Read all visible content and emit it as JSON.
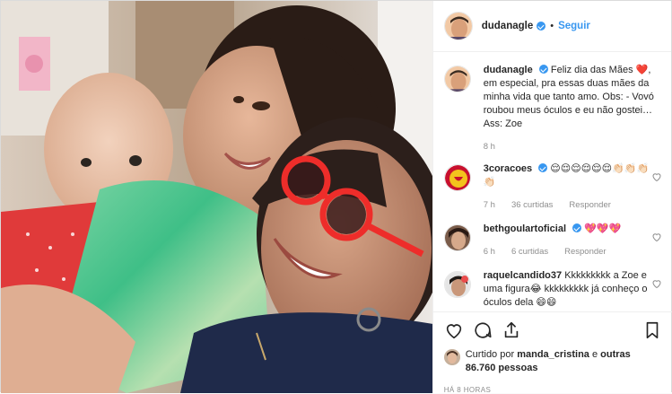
{
  "post": {
    "author": "dudanagle",
    "follow_label": "Seguir",
    "separator": "•"
  },
  "caption": {
    "author": "dudanagle",
    "text_1": "Feliz dia das Mães",
    "text_2": ", em especial, pra essas duas mães da minha vida que tanto amo. Obs: - Vovó roubou meus óculos e eu não gostei… Ass: Zoe",
    "emoji": "❤️",
    "time": "8 h"
  },
  "comments": [
    {
      "user": "3coracoes",
      "verified": true,
      "text": "😌😌😌😌😌😌👏🏻👏🏻👏🏻👏🏻",
      "time": "7 h",
      "likes": "36 curtidas",
      "reply": "Responder"
    },
    {
      "user": "bethgoulartoficial",
      "verified": true,
      "text": "💖💖💖",
      "time": "6 h",
      "likes": "6 curtidas",
      "reply": "Responder"
    },
    {
      "user": "raquelcandido37",
      "verified": false,
      "text": "Kkkkkkkkk a Zoe e uma figura😂 kkkkkkkkk já conheço o óculos dela 😄😄"
    }
  ],
  "likes": {
    "prefix": "Curtido por",
    "user": "manda_cristina",
    "suffix": "e",
    "others": "outras 86.760 pessoas"
  },
  "timestamp": "HÁ 8 HORAS",
  "colors": {
    "accent": "#3897f0",
    "muted": "#8e8e8e",
    "border": "#efefef"
  },
  "icons": [
    "heart-icon",
    "comment-icon",
    "share-icon",
    "bookmark-icon",
    "verified-badge-icon"
  ]
}
